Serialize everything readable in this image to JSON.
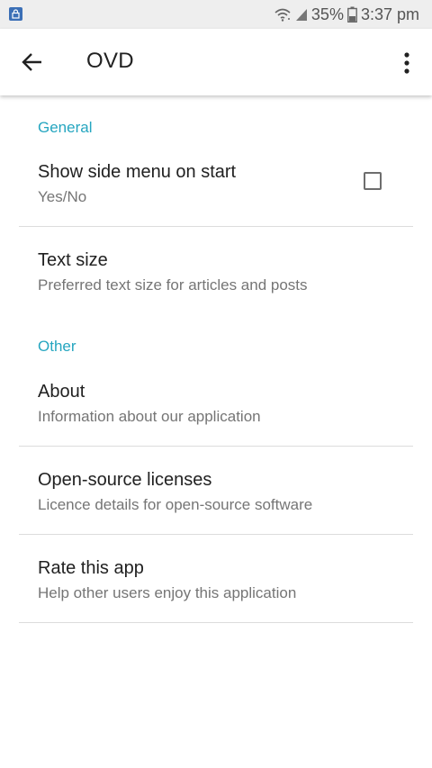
{
  "status_bar": {
    "battery": "35%",
    "time": "3:37 pm",
    "icons": [
      "lock-app-icon",
      "wifi-icon",
      "signal-icon",
      "battery-icon"
    ]
  },
  "app_bar": {
    "title": "OVD",
    "back_icon": "arrow-left-icon",
    "menu_icon": "more-vert-icon"
  },
  "sections": {
    "general": {
      "header": "General",
      "items": {
        "side_menu": {
          "title": "Show side menu on start",
          "summary": "Yes/No",
          "checked": false
        },
        "text_size": {
          "title": "Text size",
          "summary": "Preferred text size for articles and posts"
        }
      }
    },
    "other": {
      "header": "Other",
      "items": {
        "about": {
          "title": "About",
          "summary": "Information about our application"
        },
        "licenses": {
          "title": "Open-source licenses",
          "summary": "Licence details for open-source software"
        },
        "rate": {
          "title": "Rate this app",
          "summary": "Help other users enjoy this application"
        }
      }
    }
  },
  "colors": {
    "accent": "#26a6c0",
    "status_bar_bg": "#eeeeee",
    "primary_text": "#212121",
    "secondary_text": "#757575"
  }
}
